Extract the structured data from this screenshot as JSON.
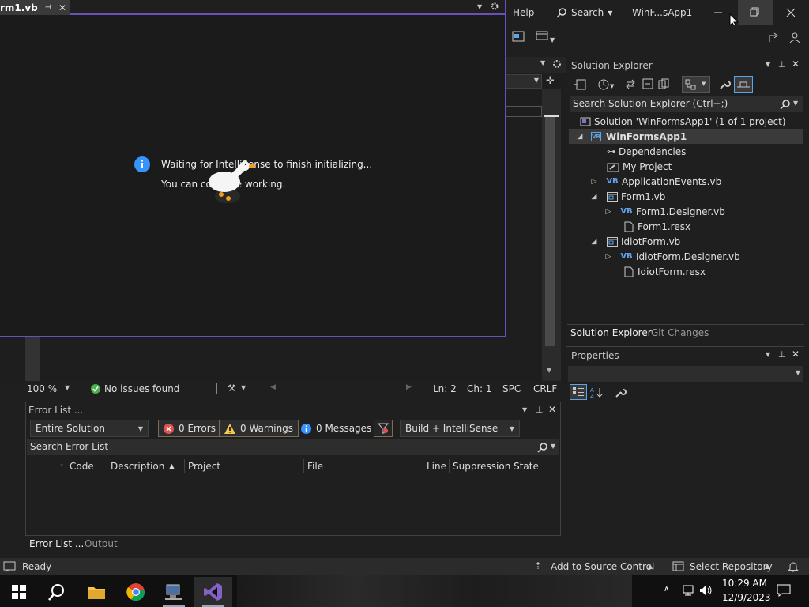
{
  "titlebar": {
    "menu_help": "Help",
    "search_label": "Search",
    "window_title": "WinF...sApp1"
  },
  "doc": {
    "tab_label": "rm1.vb",
    "info_line1": "Waiting for IntelliSense to finish initializing...",
    "info_line2": "You can continue working."
  },
  "editor_status": {
    "zoom": "100 %",
    "issues": "No issues found",
    "line": "Ln: 2",
    "col": "Ch: 1",
    "whitespace": "SPC",
    "eol": "CRLF"
  },
  "solution_explorer": {
    "title": "Solution Explorer",
    "search_placeholder": "Search Solution Explorer (Ctrl+;)",
    "items": [
      {
        "label": "Solution 'WinFormsApp1' (1 of 1 project)"
      },
      {
        "label": "WinFormsApp1"
      },
      {
        "label": "Dependencies"
      },
      {
        "label": "My Project"
      },
      {
        "label": "ApplicationEvents.vb"
      },
      {
        "label": "Form1.vb"
      },
      {
        "label": "Form1.Designer.vb"
      },
      {
        "label": "Form1.resx"
      },
      {
        "label": "IdiotForm.vb"
      },
      {
        "label": "IdiotForm.Designer.vb"
      },
      {
        "label": "IdiotForm.resx"
      }
    ],
    "tab_solution": "Solution Explorer",
    "tab_git": "Git Changes"
  },
  "properties": {
    "title": "Properties"
  },
  "error_list": {
    "title": "Error List ...",
    "scope": "Entire Solution",
    "errors": "0 Errors",
    "warnings": "0 Warnings",
    "messages": "0 Messages",
    "build_filter": "Build + IntelliSense",
    "search_placeholder": "Search Error List",
    "columns": [
      "Code",
      "Description",
      "Project",
      "File",
      "Line",
      "Suppression State"
    ],
    "tab_errors": "Error List ...",
    "tab_output": "Output"
  },
  "statusbar": {
    "ready": "Ready",
    "add_source": "Add to Source Control",
    "select_repo": "Select Repository"
  },
  "taskbar": {
    "time": "10:29 AM",
    "date": "12/9/2023"
  },
  "colors": {
    "accent": "#6b4fbb",
    "vb_blue": "#5fa3e8",
    "error_red": "#e05252",
    "warning_yellow": "#f2c94c",
    "info_blue": "#3794ff",
    "ok_green": "#4caf50"
  }
}
